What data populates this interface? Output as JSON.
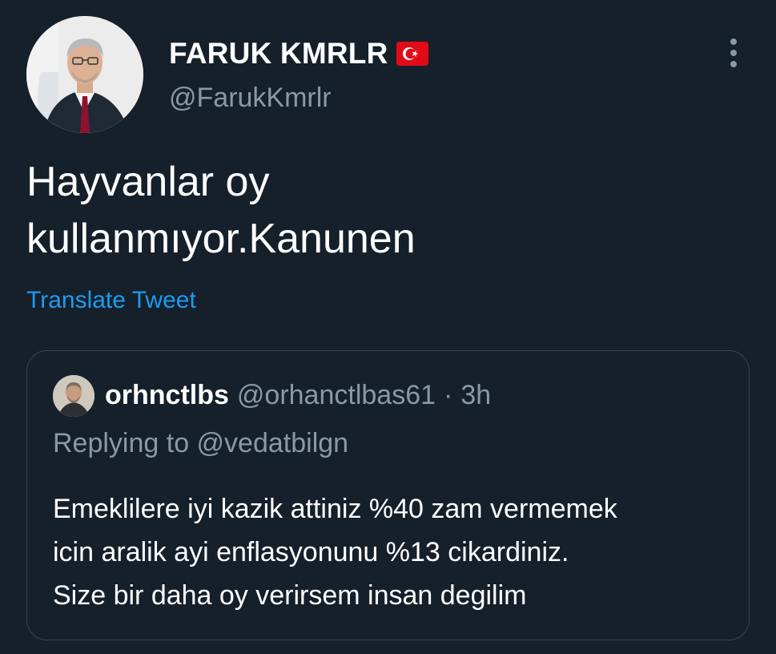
{
  "author": {
    "name": "FARUK KMRLR",
    "handle": "@FarukKmrlr",
    "flag_icon": "turkey-flag-emoji"
  },
  "tweet": {
    "text_lines": [
      "Hayvanlar oy",
      "kullanmıyor.Kanunen"
    ],
    "translate_label": "Translate Tweet"
  },
  "quoted_tweet": {
    "name": "orhnctlbs",
    "handle": "@orhanctlbas61",
    "separator": "·",
    "time": "3h",
    "replying_to": "Replying to @vedatbilgn",
    "text_lines": [
      "Emeklilere iyi kazik attiniz %40 zam vermemek",
      "icin aralik ayi enflasyonunu %13 cikardiniz.",
      "Size bir daha oy verirsem insan degilim"
    ]
  },
  "icons": {
    "more": "more-vertical-icon"
  },
  "colors": {
    "background": "#15202b",
    "primary_text": "#ffffff",
    "secondary_text": "#8b98a5",
    "link": "#1d9bf0",
    "border": "#38444d",
    "flag_red": "#e30a17"
  }
}
